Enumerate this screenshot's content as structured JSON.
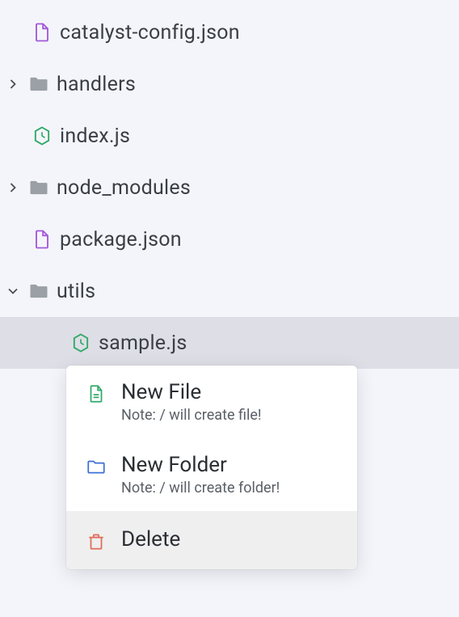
{
  "tree": {
    "catalyst_config": "catalyst-config.json",
    "handlers": "handlers",
    "index_js": "index.js",
    "node_modules": "node_modules",
    "package_json": "package.json",
    "utils": "utils",
    "sample_js": "sample.js"
  },
  "context_menu": {
    "new_file": {
      "title": "New File",
      "note": "Note: / will create file!"
    },
    "new_folder": {
      "title": "New Folder",
      "note": "Note: / will create folder!"
    },
    "delete": {
      "title": "Delete"
    }
  }
}
